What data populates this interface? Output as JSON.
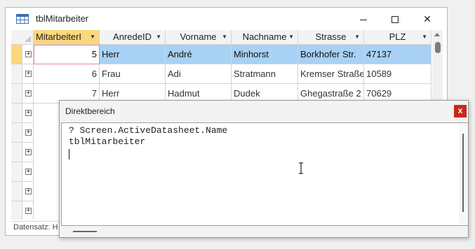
{
  "datasheet": {
    "title": "tblMitarbeiter",
    "columns": [
      {
        "label": "MitarbeiterI"
      },
      {
        "label": "AnredeID"
      },
      {
        "label": "Vorname"
      },
      {
        "label": "Nachname"
      },
      {
        "label": "Strasse"
      },
      {
        "label": "PLZ"
      }
    ],
    "rows": [
      {
        "id": "5",
        "anrede": "Herr",
        "vorname": "André",
        "nachname": "Minhorst",
        "strasse": "Borkhofer Str.",
        "plz": "47137"
      },
      {
        "id": "6",
        "anrede": "Frau",
        "vorname": "Adi",
        "nachname": "Stratmann",
        "strasse": "Kremser Straße",
        "plz": "10589"
      },
      {
        "id": "7",
        "anrede": "Herr",
        "vorname": "Hadmut",
        "nachname": "Dudek",
        "strasse": "Ghegastraße 2",
        "plz": "70629"
      }
    ],
    "expand_symbol": "+",
    "status_label": "Datensatz: H"
  },
  "immediate_window": {
    "title": "Direktbereich",
    "close_label": "x",
    "lines": [
      "? Screen.ActiveDatasheet.Name",
      "tblMitarbeiter"
    ]
  },
  "colors": {
    "selected_row": "#a9d1f4",
    "active_header": "#fcd77d",
    "close_button": "#c42b1c"
  }
}
